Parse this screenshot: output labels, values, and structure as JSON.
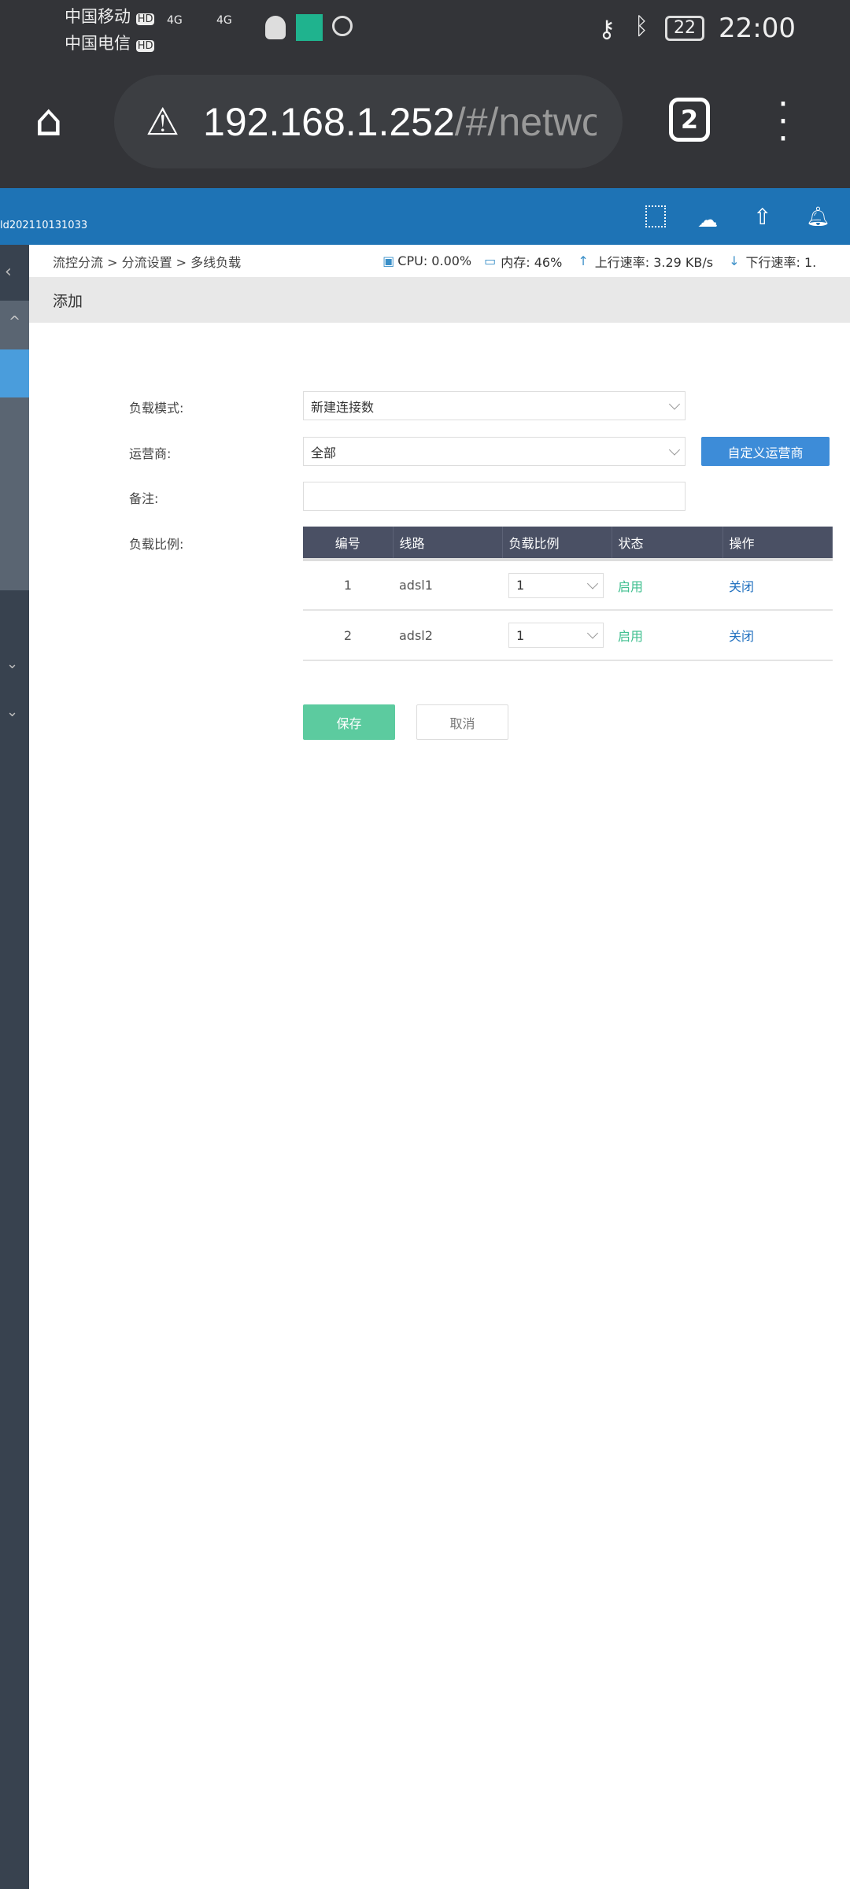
{
  "status_bar": {
    "carrier1": "中国移动",
    "carrier2": "中国电信",
    "hd": "HD",
    "net": "4G",
    "battery": "22",
    "time": "22:00"
  },
  "browser": {
    "url_host": "192.168.1.252",
    "url_path": "/#/netwo",
    "tab_count": "2"
  },
  "app_header": {
    "device_id": "ld202110131033"
  },
  "breadcrumb": {
    "text": "流控分流 > 分流设置 > 多线负载"
  },
  "stats": {
    "cpu": "CPU: 0.00%",
    "mem": "内存: 46%",
    "up": "上行速率: 3.29 KB/s",
    "down": "下行速率: 1."
  },
  "page_title": "添加",
  "form": {
    "mode_label": "负载模式:",
    "mode_value": "新建连接数",
    "isp_label": "运营商:",
    "isp_value": "全部",
    "custom_isp_button": "自定义运营商",
    "remark_label": "备注:",
    "remark_value": "",
    "ratio_label": "负载比例:"
  },
  "table": {
    "headers": [
      "编号",
      "线路",
      "负载比例",
      "状态",
      "操作"
    ],
    "rows": [
      {
        "id": "1",
        "line": "adsl1",
        "ratio": "1",
        "status": "启用",
        "action": "关闭"
      },
      {
        "id": "2",
        "line": "adsl2",
        "ratio": "1",
        "status": "启用",
        "action": "关闭"
      }
    ]
  },
  "buttons": {
    "save": "保存",
    "cancel": "取消"
  },
  "colors": {
    "header_blue": "#1e73b5",
    "sidebar": "#38424f",
    "save_green": "#5ccb9f",
    "primary_blue": "#3d8cd8"
  }
}
